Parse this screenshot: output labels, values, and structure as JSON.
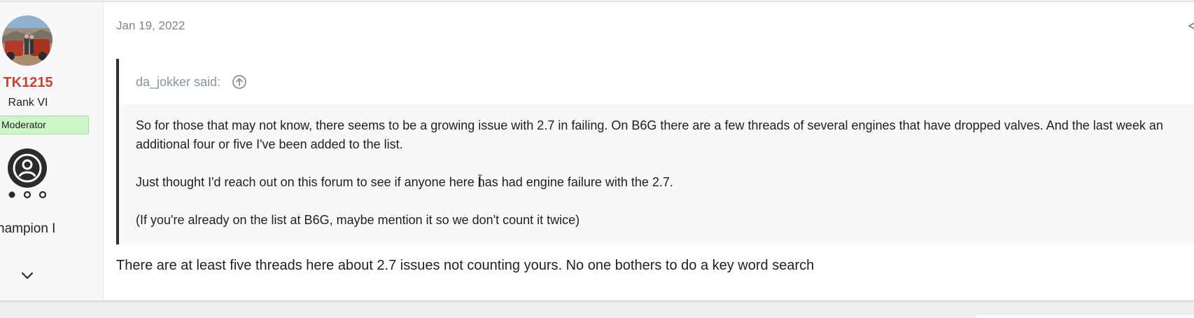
{
  "user": {
    "name": "TK1215",
    "rank": "Rank VI",
    "badge": "Moderator",
    "trophy_title": "hampion I"
  },
  "post": {
    "date": "Jan 19, 2022",
    "reply": "There are at least five threads here about 2.7 issues not counting yours. No one bothers to do a key word search"
  },
  "quote": {
    "author": "da_jokker said:",
    "paragraphs": [
      "So for those that may not know, there seems to be a growing issue with 2.7 in failing. On B6G there are a few threads of several engines that have dropped valves. And the last week an additional four or five I've been added to the list.",
      "Just thought I'd reach out on this forum to see if anyone here has had engine failure with the 2.7.",
      "(If you're already on the list at B6G, maybe mention it so we don't count it twice)"
    ]
  },
  "icons": {
    "trophy": "trophy-user-icon",
    "expand": "chevron-down-icon",
    "quote_link": "arrow-up-circle-icon",
    "share": "share-icon"
  },
  "colors": {
    "username": "#d1402a",
    "moderator_bg": "#ccf5c8",
    "quote_border": "#2c2f33",
    "muted_text": "#8394a0"
  }
}
